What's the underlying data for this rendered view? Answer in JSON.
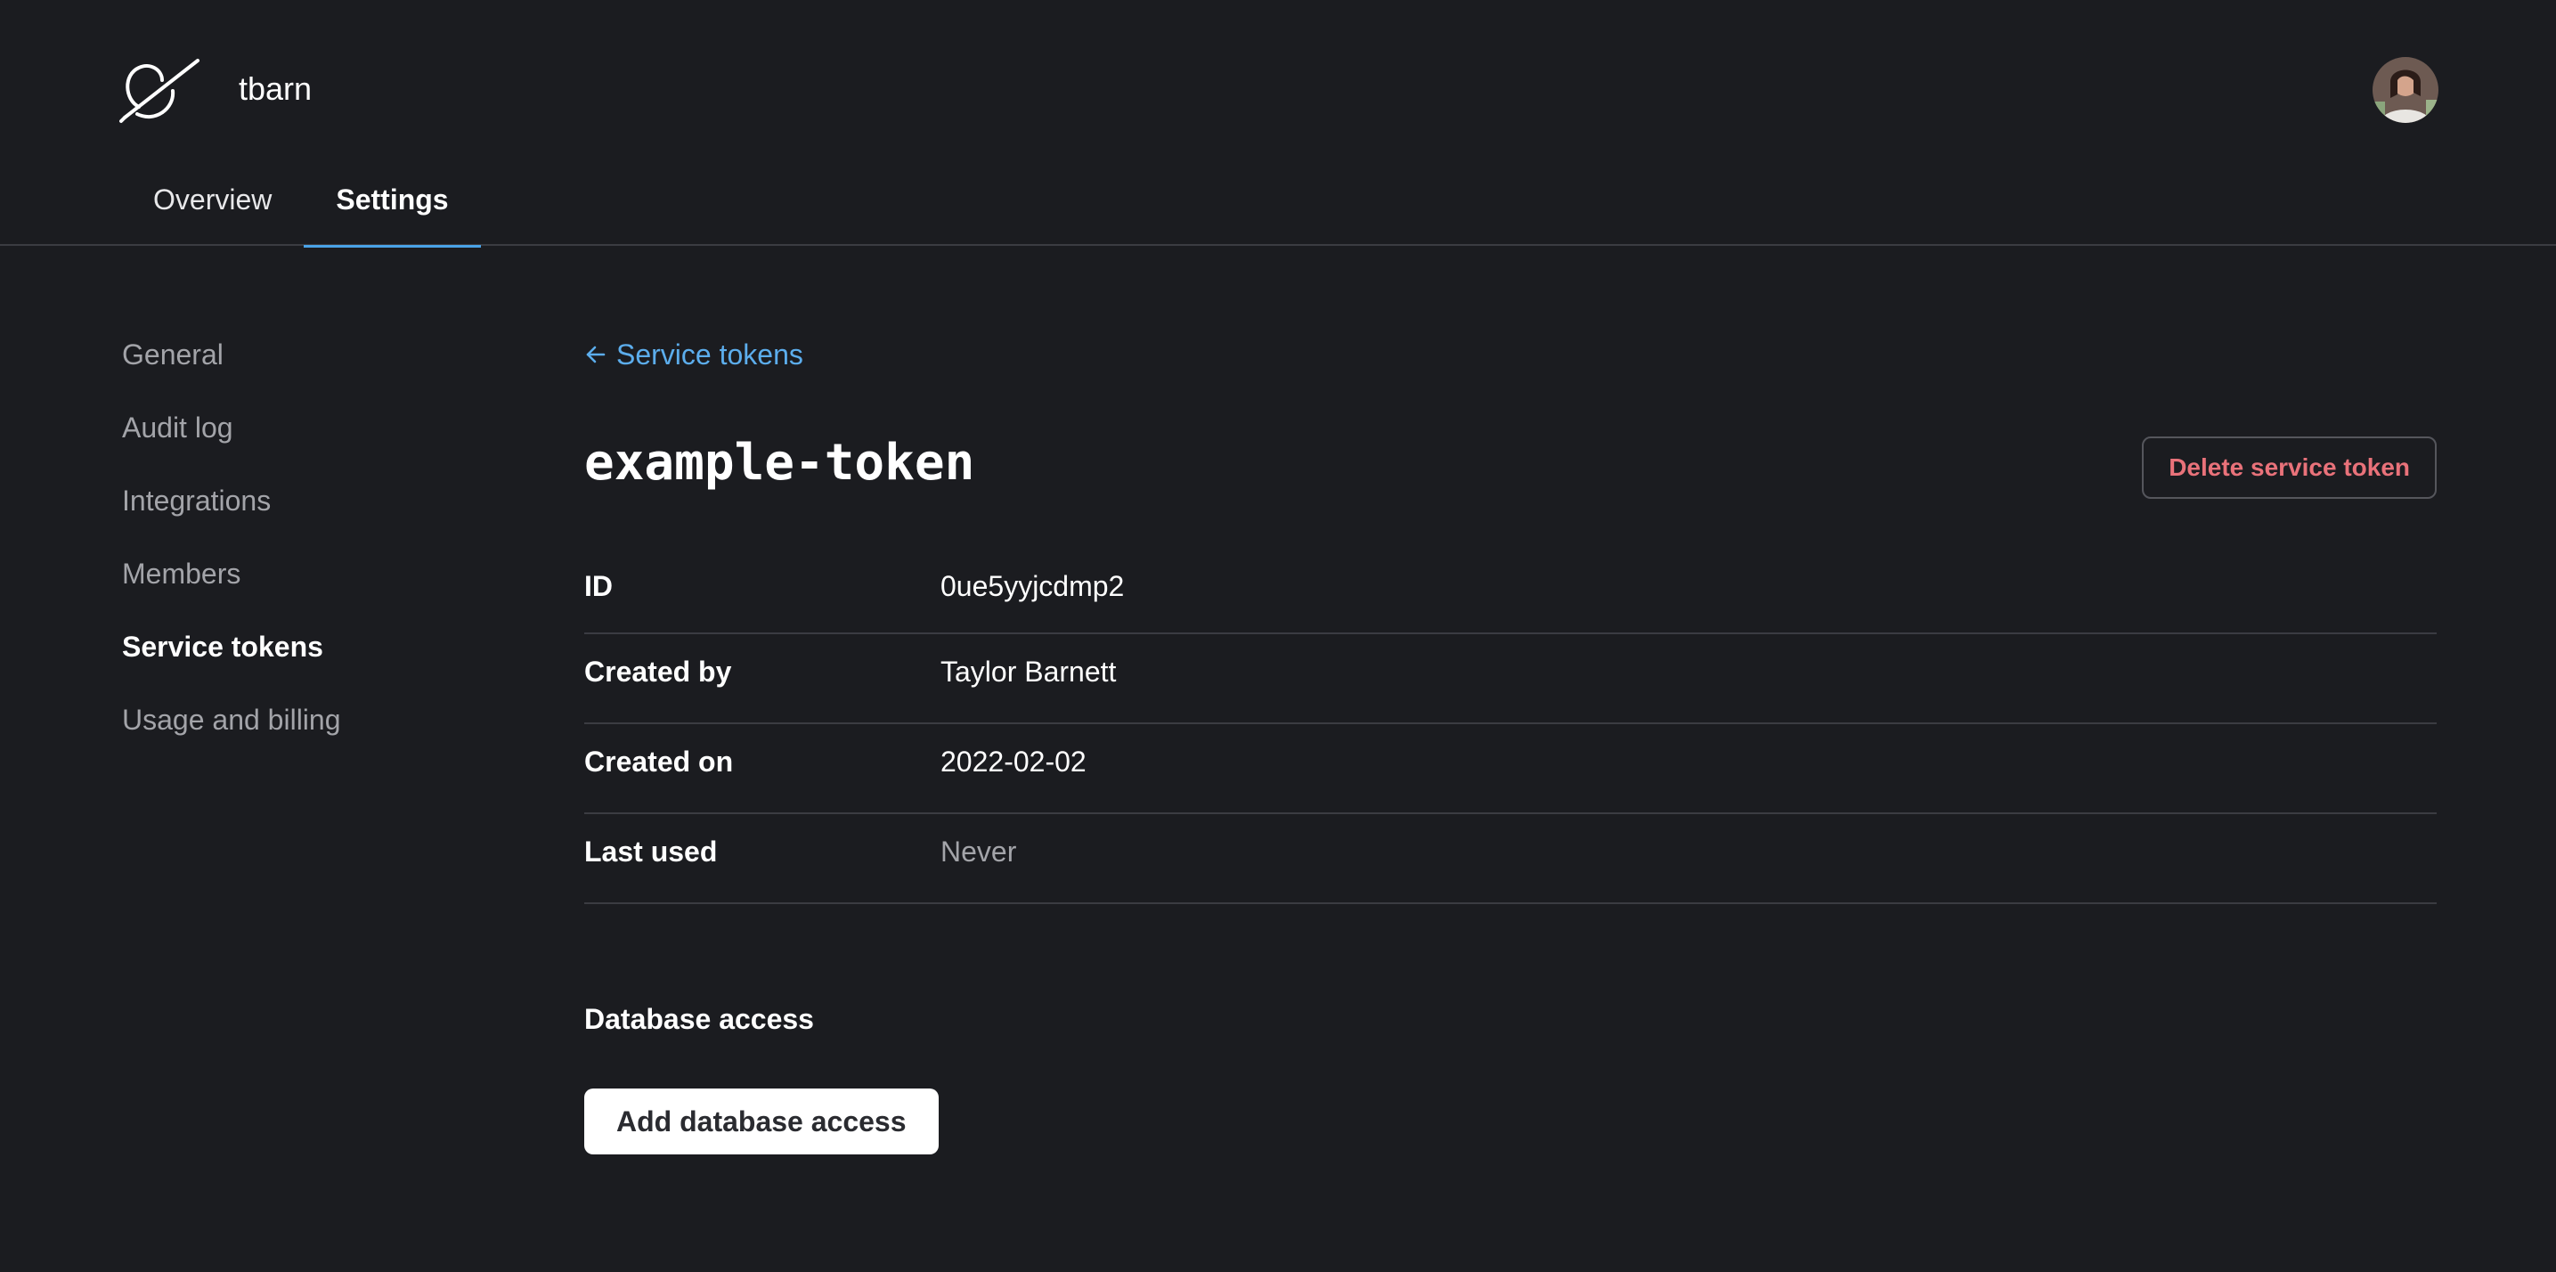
{
  "header": {
    "org_name": "tbarn"
  },
  "tabs": [
    {
      "label": "Overview",
      "active": false
    },
    {
      "label": "Settings",
      "active": true
    }
  ],
  "sidebar": {
    "items": [
      {
        "label": "General"
      },
      {
        "label": "Audit log"
      },
      {
        "label": "Integrations"
      },
      {
        "label": "Members"
      },
      {
        "label": "Service tokens",
        "active": true
      },
      {
        "label": "Usage and billing"
      }
    ]
  },
  "main": {
    "back_label": "Service tokens",
    "token_name": "example-token",
    "delete_label": "Delete service token",
    "details": [
      {
        "label": "ID",
        "value": "0ue5yyjcdmp2"
      },
      {
        "label": "Created by",
        "value": "Taylor Barnett"
      },
      {
        "label": "Created on",
        "value": "2022-02-02"
      },
      {
        "label": "Last used",
        "value": "Never"
      }
    ],
    "database_access_title": "Database access",
    "add_access_label": "Add database access"
  },
  "colors": {
    "background": "#1b1c20",
    "accent": "#4aa3e8",
    "link": "#5cadec",
    "danger": "#e9727a",
    "muted": "#a3a4a9",
    "divider": "#3b3c42"
  }
}
